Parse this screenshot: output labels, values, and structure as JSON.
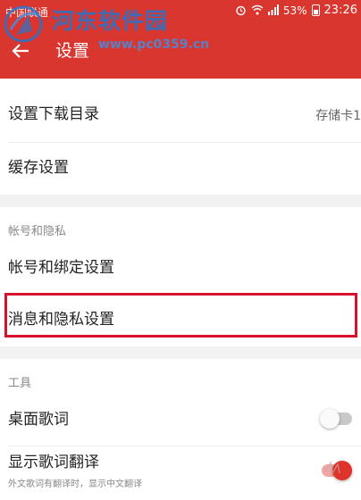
{
  "status_bar": {
    "carrier": "中国联通",
    "battery": "53%",
    "time": "23:26",
    "icons": [
      "alarm-icon",
      "wifi-icon",
      "signal-icon",
      "battery-icon"
    ]
  },
  "toolbar": {
    "title": "设置",
    "back_icon": "back-arrow-icon"
  },
  "watermark": {
    "title": "河东软件园",
    "url": "www.pc0359.cn"
  },
  "sections": {
    "download": {
      "items": [
        {
          "label": "设置下载目录",
          "value": "存储卡1"
        },
        {
          "label": "缓存设置"
        }
      ]
    },
    "account": {
      "header": "帐号和隐私",
      "items": [
        {
          "label": "帐号和绑定设置"
        },
        {
          "label": "消息和隐私设置"
        }
      ]
    },
    "tools": {
      "header": "工具",
      "items": [
        {
          "label": "桌面歌词",
          "toggle": "off"
        },
        {
          "label": "显示歌词翻译",
          "sublabel": "外文歌词有翻译时，显示中文翻译",
          "toggle": "on"
        }
      ]
    }
  },
  "colors": {
    "brand_red": "#d9362f",
    "highlight_red": "#d8122c",
    "watermark_blue": "#2c72c7"
  }
}
